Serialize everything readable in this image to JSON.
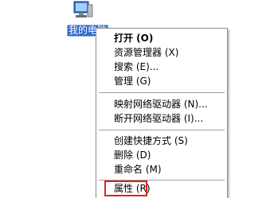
{
  "desktop": {
    "icon_name": "computer-icon",
    "icon_label": "我的电脑"
  },
  "context_menu": {
    "items": [
      {
        "label": "打开 (O)",
        "bold": true
      },
      {
        "label": "资源管理器 (X)"
      },
      {
        "label": "搜索 (E)..."
      },
      {
        "label": "管理 (G)"
      },
      {
        "label": "映射网络驱动器 (N)..."
      },
      {
        "label": "断开网络驱动器 (I)..."
      },
      {
        "label": "创建快捷方式 (S)"
      },
      {
        "label": "删除 (D)"
      },
      {
        "label": "重命名 (M)"
      },
      {
        "label": "属性 (R)"
      }
    ]
  },
  "colors": {
    "selection": "#316ac5",
    "highlight_box": "#e02020"
  }
}
